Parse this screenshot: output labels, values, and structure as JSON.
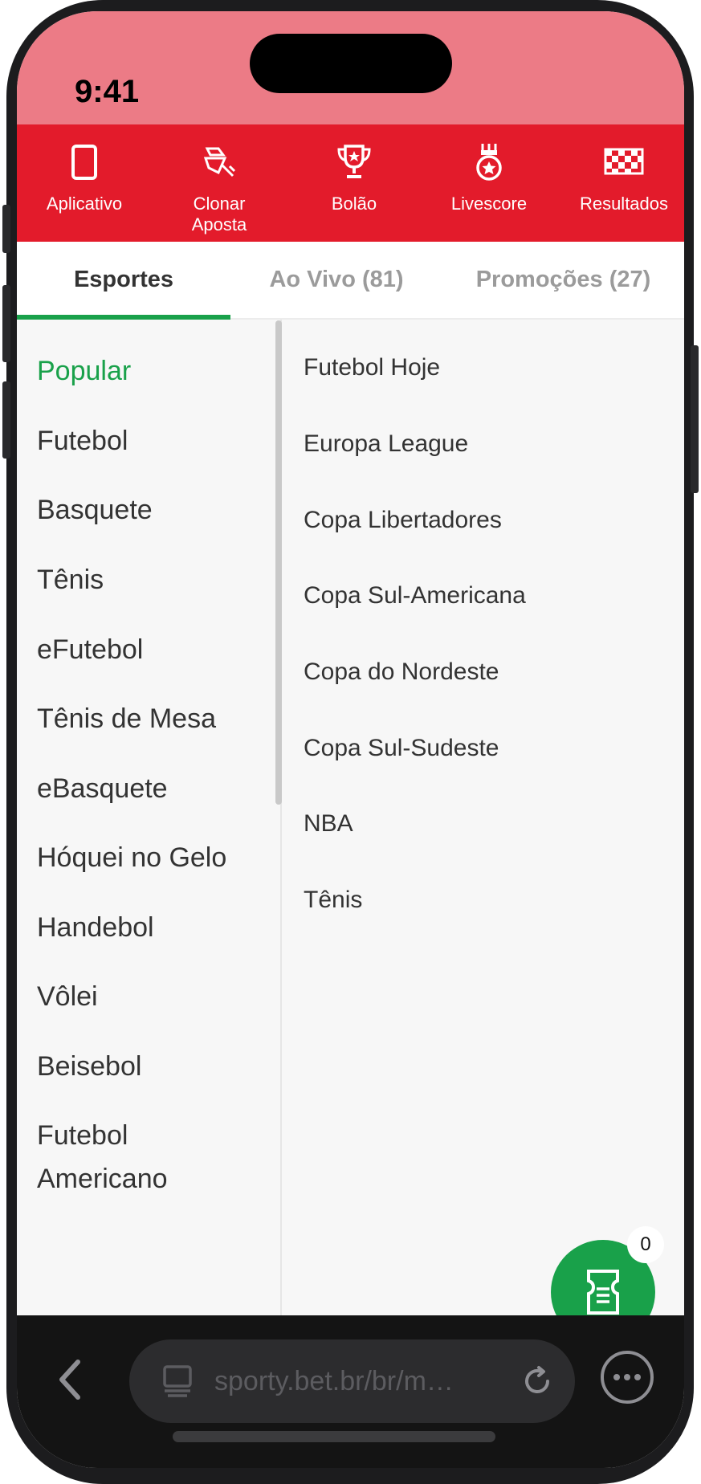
{
  "status": {
    "time": "9:41"
  },
  "top_nav": {
    "items": [
      {
        "label": "Aplicativo",
        "icon": "phone-icon"
      },
      {
        "label": "Clonar\nAposta",
        "icon": "clone-bet-icon"
      },
      {
        "label": "Bolão",
        "icon": "trophy-icon"
      },
      {
        "label": "Livescore",
        "icon": "medal-icon"
      },
      {
        "label": "Resultados",
        "icon": "checkered-flag-icon"
      }
    ]
  },
  "tabs": [
    {
      "label": "Esportes",
      "active": true
    },
    {
      "label": "Ao Vivo (81)",
      "active": false
    },
    {
      "label": "Promoções (27)",
      "active": false
    }
  ],
  "sports": [
    "Popular",
    "Futebol",
    "Basquete",
    "Tênis",
    "eFutebol",
    "Tênis de Mesa",
    "eBasquete",
    "Hóquei no Gelo",
    "Handebol",
    "Vôlei",
    "Beisebol",
    "Futebol Americano"
  ],
  "leagues": [
    "Futebol Hoje",
    "Europa League",
    "Copa Libertadores",
    "Copa Sul-Americana",
    "Copa do Nordeste",
    "Copa Sul-Sudeste",
    "NBA",
    "Tênis"
  ],
  "betslip": {
    "count": "0"
  },
  "browser": {
    "url": "sporty.bet.br/br/m…"
  },
  "colors": {
    "brand_red": "#e31b2b",
    "accent_green": "#19a14a",
    "status_pink": "#ec7b86"
  }
}
